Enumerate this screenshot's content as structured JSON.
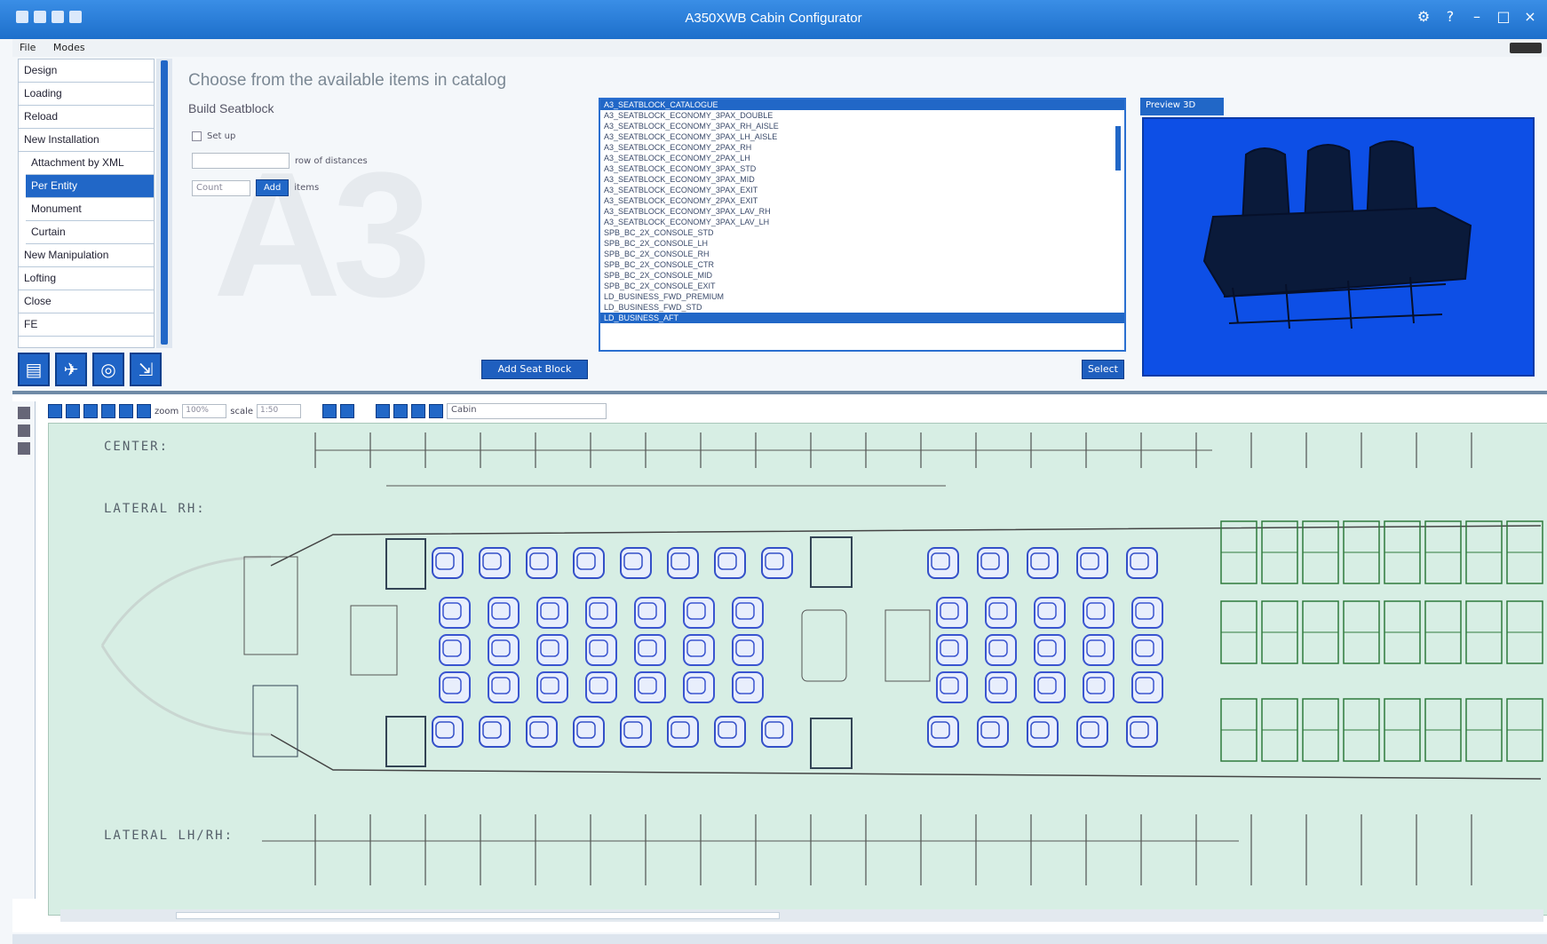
{
  "app": {
    "title": "A350XWB Cabin Configurator"
  },
  "menu": {
    "items": [
      "File",
      "Modes"
    ]
  },
  "sidebar": {
    "items": [
      {
        "label": "Design",
        "sub": false,
        "active": false
      },
      {
        "label": "Loading",
        "sub": false,
        "active": false
      },
      {
        "label": "Reload",
        "sub": false,
        "active": false
      },
      {
        "label": "New Installation",
        "sub": false,
        "active": false
      },
      {
        "label": "Attachment by XML",
        "sub": true,
        "active": false
      },
      {
        "label": "Per Entity",
        "sub": true,
        "active": true
      },
      {
        "label": "Monument",
        "sub": true,
        "active": false
      },
      {
        "label": "Curtain",
        "sub": true,
        "active": false
      },
      {
        "label": "New Manipulation",
        "sub": false,
        "active": false
      },
      {
        "label": "Lofting",
        "sub": false,
        "active": false
      },
      {
        "label": "Close",
        "sub": false,
        "active": false
      },
      {
        "label": "FE",
        "sub": false,
        "active": false
      }
    ],
    "tool_icons": [
      "open-file-icon",
      "airplane-icon",
      "globe-icon",
      "export-icon"
    ]
  },
  "catalog": {
    "heading": "Choose from the available items in catalog",
    "subheading": "Build Seatblock",
    "checkbox_label": "Set up",
    "field_suffix": "row of distances",
    "count_placeholder": "Count",
    "apply_label": "Add",
    "units_label": "items",
    "add_button": "Add Seat Block"
  },
  "item_list": {
    "items": [
      "A3_SEATBLOCK_ECONOMY_3PAX_DOUBLE",
      "A3_SEATBLOCK_ECONOMY_3PAX_RH_AISLE",
      "A3_SEATBLOCK_ECONOMY_3PAX_LH_AISLE",
      "A3_SEATBLOCK_ECONOMY_2PAX_RH",
      "A3_SEATBLOCK_ECONOMY_2PAX_LH",
      "A3_SEATBLOCK_ECONOMY_3PAX_STD",
      "A3_SEATBLOCK_ECONOMY_3PAX_MID",
      "A3_SEATBLOCK_ECONOMY_3PAX_EXIT",
      "A3_SEATBLOCK_ECONOMY_2PAX_EXIT",
      "A3_SEATBLOCK_ECONOMY_3PAX_LAV_RH",
      "A3_SEATBLOCK_ECONOMY_3PAX_LAV_LH",
      "SPB_BC_2X_CONSOLE_STD",
      "SPB_BC_2X_CONSOLE_LH",
      "SPB_BC_2X_CONSOLE_RH",
      "SPB_BC_2X_CONSOLE_CTR",
      "SPB_BC_2X_CONSOLE_MID",
      "SPB_BC_2X_CONSOLE_EXIT",
      "LD_BUSINESS_FWD_PREMIUM",
      "LD_BUSINESS_FWD_STD",
      "LD_BUSINESS_AFT"
    ],
    "selected_index": 19,
    "header": "A3_SEATBLOCK_CATALOGUE",
    "select_button": "Select"
  },
  "preview": {
    "tab_label": "Preview 3D"
  },
  "cad": {
    "toolbar": {
      "zoom_label": "zoom",
      "zoom_value": "100%",
      "scale_label": "scale",
      "scale_value": "1:50",
      "layer_value": "Cabin"
    },
    "labels": {
      "center": "CENTER:",
      "lateral_rh": "LATERAL RH:",
      "lateral_lh": "LATERAL LH/RH:"
    }
  }
}
